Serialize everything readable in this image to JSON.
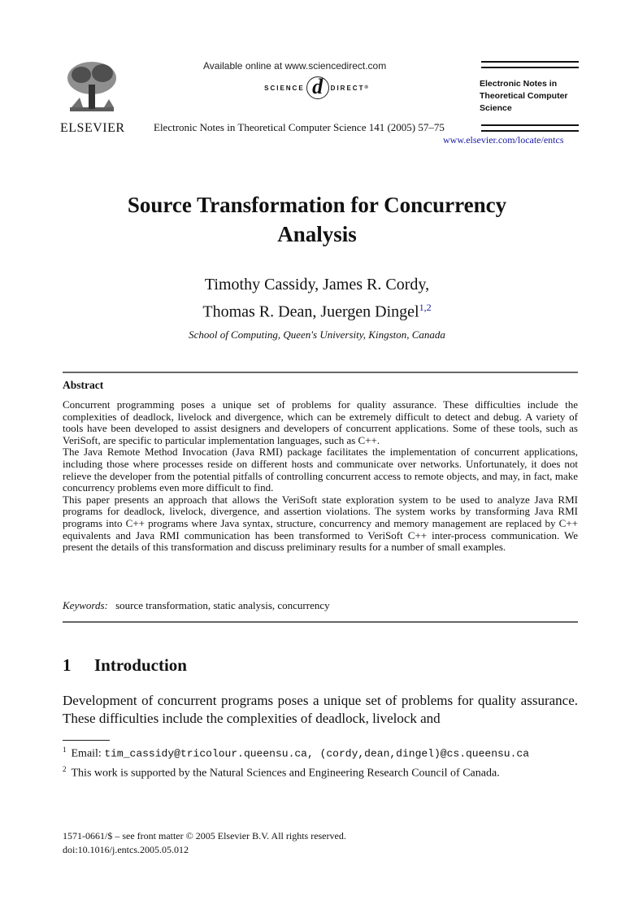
{
  "header": {
    "publisher_logo_text": "ELSEVIER",
    "available_online": "Available online at www.sciencedirect.com",
    "sciencedirect_left": "SCIENCE",
    "sciencedirect_at": "d",
    "sciencedirect_right": "DIRECT",
    "sciencedirect_mark": "®",
    "journal_citation": "Electronic Notes in Theoretical Computer Science 141 (2005) 57–75",
    "journal_box": [
      "Electronic Notes in",
      "Theoretical Computer",
      "Science"
    ],
    "journal_url": "www.elsevier.com/locate/entcs"
  },
  "paper": {
    "title_line1": "Source Transformation for Concurrency",
    "title_line2": "Analysis",
    "authors_line1": "Timothy Cassidy, James R. Cordy,",
    "authors_line2": "Thomas R. Dean, Juergen Dingel",
    "authors_footnote_marks": "1,2",
    "affiliation": "School of Computing, Queen's University, Kingston, Canada"
  },
  "abstract": {
    "heading": "Abstract",
    "paragraphs": [
      "Concurrent programming poses a unique set of problems for quality assurance. These difficulties include the complexities of deadlock, livelock and divergence, which can be extremely difficult to detect and debug. A variety of tools have been developed to assist designers and developers of concurrent applications. Some of these tools, such as VeriSoft, are specific to particular implementation languages, such as C++.",
      "The Java Remote Method Invocation (Java RMI) package facilitates the implementation of concurrent applications, including those where processes reside on different hosts and communicate over networks. Unfortunately, it does not relieve the developer from the potential pitfalls of controlling concurrent access to remote objects, and may, in fact, make concurrency problems even more difficult to find.",
      "This paper presents an approach that allows the VeriSoft state exploration system to be used to analyze Java RMI programs for deadlock, livelock, divergence, and assertion violations. The system works by transforming Java RMI programs into C++ programs where Java syntax, structure, concurrency and memory management are replaced by C++ equivalents and Java RMI communication has been transformed to VeriSoft C++ inter-process communication. We present the details of this transformation and discuss preliminary results for a number of small examples."
    ],
    "keywords_label": "Keywords:",
    "keywords": "source transformation, static analysis, concurrency"
  },
  "section1": {
    "number": "1",
    "title": "Introduction",
    "text": "Development of concurrent programs poses a unique set of problems for quality assurance. These difficulties include the complexities of deadlock, livelock and"
  },
  "footnotes": [
    {
      "mark": "1",
      "prefix": "Email: ",
      "mono": "tim_cassidy@tricolour.queensu.ca, (cordy,dean,dingel)@cs.queensu.ca"
    },
    {
      "mark": "2",
      "text": "This work is supported by the Natural Sciences and Engineering Research Council of Canada."
    }
  ],
  "bottom": {
    "issn_line": "1571-0661/$ – see front matter © 2005 Elsevier B.V. All rights reserved.",
    "doi": "doi:10.1016/j.entcs.2005.05.012"
  },
  "colors": {
    "link": "#1a1aa6",
    "rule": "#666666"
  }
}
